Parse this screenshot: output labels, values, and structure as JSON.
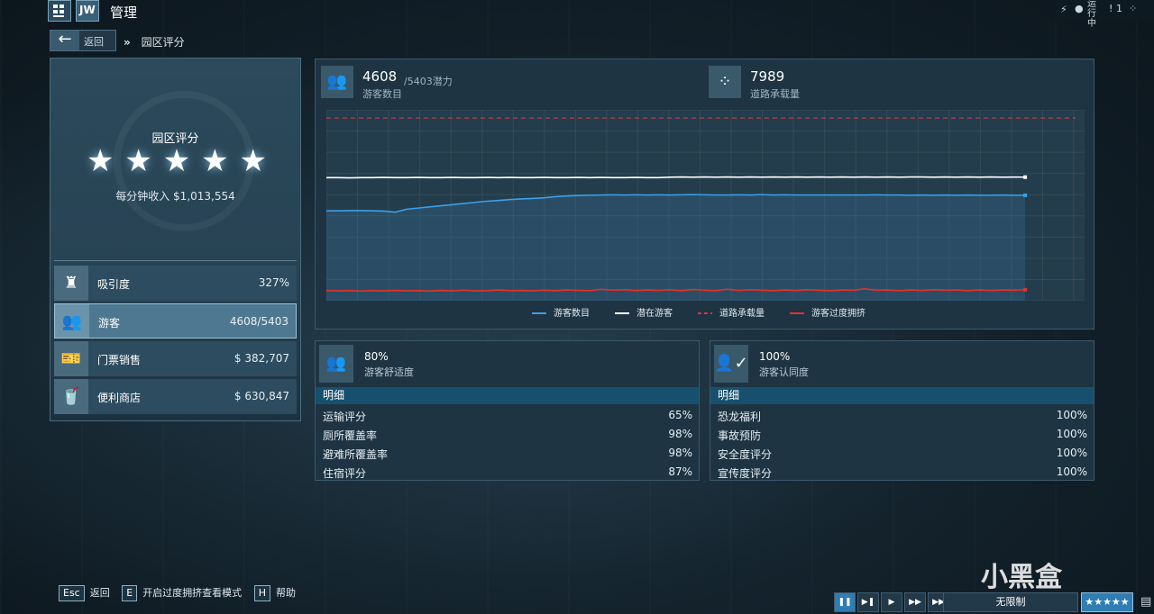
{
  "app": {
    "title": "管理",
    "logo_text": "JW",
    "status_text": "运行中",
    "notifications_count": "1"
  },
  "nav": {
    "back_label": "返回",
    "breadcrumb_current": "园区评分"
  },
  "rating_panel": {
    "title": "园区评分",
    "stars": 5,
    "income_text": "每分钟收入 $1,013,554",
    "stats": [
      {
        "name": "吸引度",
        "value": "327%",
        "icon": "attraction-icon",
        "selected": false
      },
      {
        "name": "游客",
        "value": "4608/5403",
        "icon": "guests-icon",
        "selected": true
      },
      {
        "name": "门票销售",
        "value": "$ 382,707",
        "icon": "ticket-icon",
        "selected": false
      },
      {
        "name": "便利商店",
        "value": "$ 630,847",
        "icon": "shop-icon",
        "selected": false
      }
    ]
  },
  "guest_header": {
    "guest_count": "4608",
    "guest_potential": "/5403潜力",
    "guest_label": "游客数目",
    "path_capacity": "7989",
    "path_capacity_label": "道路承载量"
  },
  "chart_data": {
    "type": "line",
    "ylim": [
      0,
      7989
    ],
    "grid": true,
    "legend_position": "bottom",
    "series": [
      {
        "name": "游客数目",
        "color": "#3aa0ea",
        "dashed": false,
        "values": [
          3930,
          3930,
          3940,
          3940,
          3930,
          3920,
          3870,
          4000,
          4050,
          4100,
          4150,
          4200,
          4250,
          4300,
          4350,
          4380,
          4420,
          4450,
          4470,
          4500,
          4550,
          4580,
          4600,
          4610,
          4620,
          4630,
          4620,
          4630,
          4620,
          4630,
          4620,
          4630,
          4640,
          4630,
          4620,
          4620,
          4630,
          4620,
          4640,
          4620,
          4630,
          4620,
          4620,
          4620,
          4620,
          4620,
          4620,
          4620,
          4630,
          4620,
          4620,
          4610,
          4620,
          4610,
          4620,
          4610,
          4620,
          4610,
          4610,
          4620,
          4610,
          4610
        ]
      },
      {
        "name": "潜在游客",
        "color": "#ffffff",
        "dashed": false,
        "values": [
          5380,
          5380,
          5370,
          5380,
          5380,
          5390,
          5380,
          5380,
          5390,
          5380,
          5380,
          5390,
          5380,
          5380,
          5390,
          5380,
          5390,
          5380,
          5380,
          5390,
          5380,
          5380,
          5390,
          5380,
          5390,
          5380,
          5380,
          5390,
          5380,
          5380,
          5400,
          5410,
          5400,
          5410,
          5400,
          5410,
          5400,
          5410,
          5400,
          5410,
          5400,
          5410,
          5400,
          5410,
          5400,
          5410,
          5400,
          5410,
          5400,
          5410,
          5400,
          5410,
          5410,
          5400,
          5410,
          5400,
          5410,
          5400,
          5410,
          5400,
          5405,
          5403
        ]
      },
      {
        "name": "道路承载量",
        "color": "#d03a3a",
        "dashed": true,
        "values": [
          7989,
          7989
        ]
      },
      {
        "name": "游客过度拥挤",
        "color": "#e8302a",
        "dashed": false,
        "values": [
          440,
          430,
          440,
          420,
          440,
          430,
          450,
          430,
          440,
          420,
          450,
          430,
          460,
          430,
          440,
          470,
          440,
          450,
          430,
          460,
          440,
          470,
          450,
          440,
          500,
          460,
          480,
          440,
          470,
          450,
          480,
          440,
          490,
          460,
          440,
          500,
          450,
          480,
          460,
          440,
          470,
          450,
          480,
          460,
          440,
          470,
          460,
          520,
          460,
          470,
          440,
          470,
          450,
          480,
          460,
          470,
          440,
          470,
          450,
          470,
          460,
          480
        ]
      }
    ]
  },
  "comfort_panel": {
    "percent": "80%",
    "label": "游客舒适度",
    "detail_header": "明细",
    "rows": [
      {
        "k": "运输评分",
        "v": "65%"
      },
      {
        "k": "厕所覆盖率",
        "v": "98%"
      },
      {
        "k": "避难所覆盖率",
        "v": "98%"
      },
      {
        "k": "住宿评分",
        "v": "87%"
      }
    ]
  },
  "approval_panel": {
    "percent": "100%",
    "label": "游客认同度",
    "detail_header": "明细",
    "rows": [
      {
        "k": "恐龙福利",
        "v": "100%"
      },
      {
        "k": "事故预防",
        "v": "100%"
      },
      {
        "k": "安全度评分",
        "v": "100%"
      },
      {
        "k": "宣传度评分",
        "v": "100%"
      }
    ]
  },
  "footer": {
    "hints": [
      {
        "key": "Esc",
        "text": "返回"
      },
      {
        "key": "E",
        "text": "开启过度拥挤查看模式"
      },
      {
        "key": "H",
        "text": "帮助"
      }
    ],
    "speed_label": "无限制",
    "rating_stars": "★★★★★"
  },
  "watermark": "小黑盒"
}
